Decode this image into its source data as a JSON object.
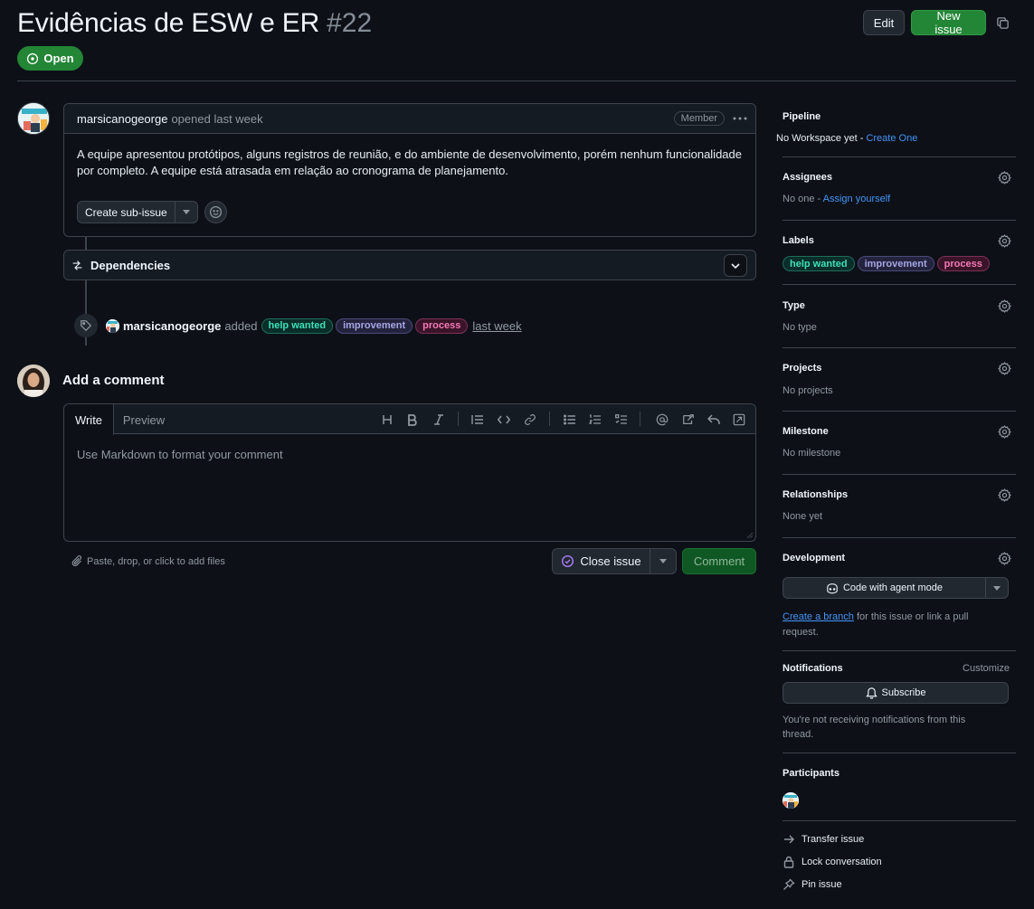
{
  "header": {
    "title": "Evidências de ESW e ER",
    "number": "#22",
    "edit_label": "Edit",
    "new_issue_label": "New issue",
    "state": "Open",
    "colors": {
      "open_green": "#238636",
      "background": "#0d1117",
      "link": "#4493f8"
    }
  },
  "comment": {
    "author": "marsicanogeorge",
    "meta": "opened last week",
    "role_badge": "Member",
    "body": "A equipe apresentou protótipos, alguns registros de reunião, e do ambiente de desenvolvimento, porém nenhum funcionalidade por completo. A equipe está atrasada em relação ao cronograma de planejamento.",
    "sub_issue_label": "Create sub-issue"
  },
  "dependencies": {
    "title": "Dependencies"
  },
  "label_event": {
    "actor": "marsicanogeorge",
    "verb": "added",
    "time": "last week",
    "labels": [
      "help wanted",
      "improvement",
      "process"
    ]
  },
  "composer": {
    "heading": "Add a comment",
    "tab_write": "Write",
    "tab_preview": "Preview",
    "placeholder": "Use Markdown to format your comment",
    "attach_hint": "Paste, drop, or click to add files",
    "close_issue_label": "Close issue",
    "comment_label": "Comment",
    "toolbar_icons": [
      "heading-icon",
      "bold-icon",
      "italic-icon",
      "quote-icon",
      "code-icon",
      "link-icon",
      "bulleted-list-icon",
      "numbered-list-icon",
      "task-list-icon",
      "mention-icon",
      "reference-icon",
      "saved-reply-icon",
      "fullscreen-icon"
    ]
  },
  "sidebar": {
    "pipeline": {
      "title": "Pipeline",
      "text": "No Workspace yet - ",
      "link": "Create One"
    },
    "assignees": {
      "title": "Assignees",
      "text": "No one - ",
      "link": "Assign yourself"
    },
    "labels": {
      "title": "Labels",
      "items": [
        "help wanted",
        "improvement",
        "process"
      ]
    },
    "type": {
      "title": "Type",
      "text": "No type"
    },
    "projects": {
      "title": "Projects",
      "text": "No projects"
    },
    "milestone": {
      "title": "Milestone",
      "text": "No milestone"
    },
    "relationships": {
      "title": "Relationships",
      "text": "None yet"
    },
    "development": {
      "title": "Development",
      "agent_label": "Code with agent mode",
      "branch_link": "Create a branch",
      "branch_text": " for this issue or link a pull",
      "branch_text2": "request."
    },
    "notifications": {
      "title": "Notifications",
      "customize": "Customize",
      "subscribe_label": "Subscribe",
      "status_line1": "You're not receiving notifications from this",
      "status_line2": "thread."
    },
    "participants": {
      "title": "Participants"
    },
    "actions": {
      "transfer": "Transfer issue",
      "lock": "Lock conversation",
      "pin": "Pin issue"
    }
  }
}
